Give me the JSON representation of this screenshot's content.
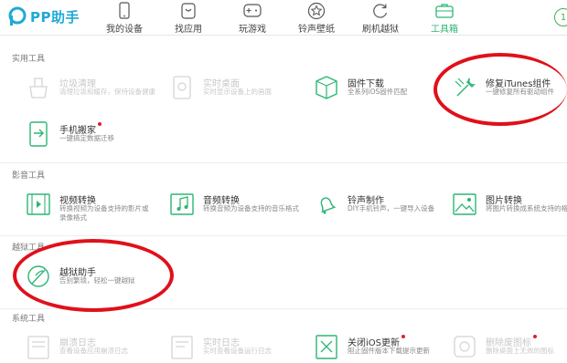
{
  "app": {
    "logo_text": "PP助手"
  },
  "nav": {
    "tabs": [
      {
        "label": "我的设备",
        "icon": "phone-icon"
      },
      {
        "label": "找应用",
        "icon": "app-store-icon"
      },
      {
        "label": "玩游戏",
        "icon": "gamepad-icon"
      },
      {
        "label": "铃声壁纸",
        "icon": "star-icon"
      },
      {
        "label": "刷机越狱",
        "icon": "refresh-icon"
      },
      {
        "label": "工具箱",
        "icon": "toolbox-icon"
      }
    ],
    "active": "工具箱",
    "sync_glyph": "1"
  },
  "sections": {
    "practical": {
      "title": "实用工具",
      "tools": [
        {
          "title": "垃圾清理",
          "desc": "清理垃圾和缓存，保持设备健康",
          "icon": "broom-icon",
          "dim": true
        },
        {
          "title": "实时桌面",
          "desc": "实时显示设备上的画面",
          "icon": "desktop-icon",
          "dim": true
        },
        {
          "title": "固件下载",
          "desc": "全系列iOS固件匹配",
          "icon": "box-icon",
          "dim": false
        },
        {
          "title": "修复iTunes组件",
          "desc": "一键修复所有驱动组件",
          "icon": "wrench-icon",
          "dim": false
        },
        {
          "title": "手机搬家",
          "desc": "一键搞定数据迁移",
          "icon": "migrate-icon",
          "dim": false,
          "new": true
        }
      ]
    },
    "media": {
      "title": "影音工具",
      "tools": [
        {
          "title": "视频转换",
          "desc": "转换视频为设备支持的影片或\n录像格式",
          "icon": "video-icon"
        },
        {
          "title": "音频转换",
          "desc": "转换音频为设备支持的音乐格式",
          "icon": "audio-icon"
        },
        {
          "title": "铃声制作",
          "desc": "DIY手机铃声，一键导入设备",
          "icon": "bell-icon"
        },
        {
          "title": "图片转换",
          "desc": "将图片转换成系统支持的格式",
          "icon": "image-icon"
        }
      ]
    },
    "jailbreak": {
      "title": "越狱工具",
      "tools": [
        {
          "title": "越狱助手",
          "desc": "告别繁琐，轻松一键越狱",
          "icon": "jailbreak-icon"
        }
      ]
    },
    "system": {
      "title": "系统工具",
      "tools": [
        {
          "title": "崩溃日志",
          "desc": "查看设备应用崩溃日志",
          "icon": "log-icon",
          "dim": true
        },
        {
          "title": "实时日志",
          "desc": "实时查看设备运行日志",
          "icon": "log2-icon",
          "dim": true
        },
        {
          "title": "关闭iOS更新",
          "desc": "阻止固件版本下载提示更新",
          "icon": "no-update-icon",
          "dim": false,
          "new": true
        },
        {
          "title": "删除废图标",
          "desc": "删除桌面上无效的图标",
          "icon": "delete-icon-icon",
          "dim": true,
          "new": true
        }
      ]
    }
  },
  "colors": {
    "accent": "#2bb673",
    "logo": "#1fa9d6",
    "highlight": "#e0101a",
    "new_dot": "#e0202a"
  }
}
